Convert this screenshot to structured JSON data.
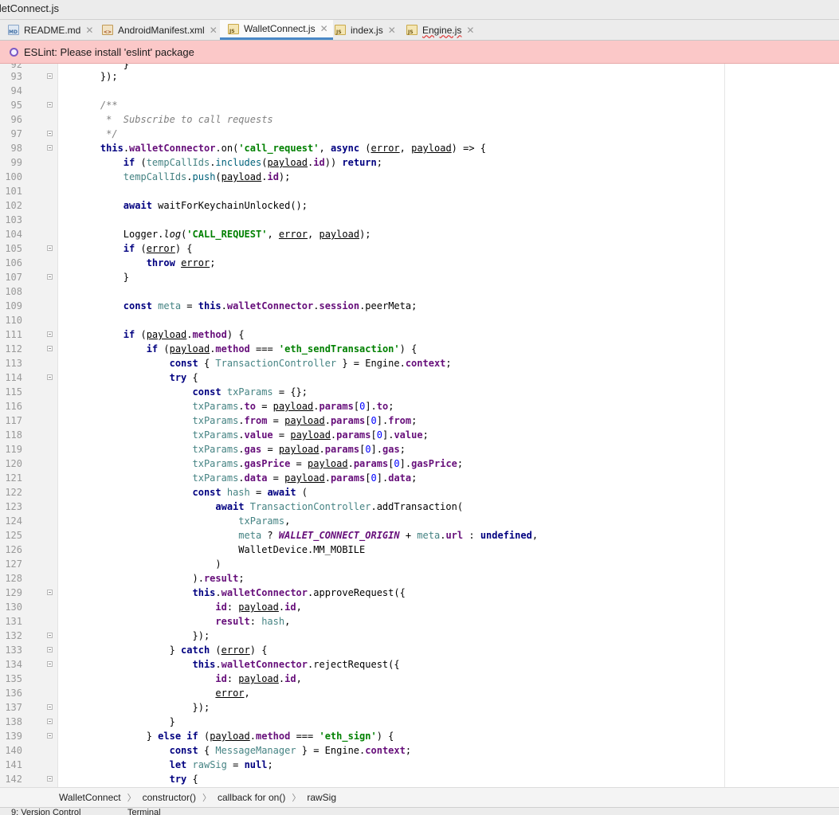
{
  "window": {
    "title": "lletConnect.js"
  },
  "tabs": [
    {
      "label": "README.md",
      "icon": "markdown-file-icon"
    },
    {
      "label": "AndroidManifest.xml",
      "icon": "xml-file-icon"
    },
    {
      "label": "WalletConnect.js",
      "icon": "js-file-icon",
      "active": true
    },
    {
      "label": "index.js",
      "icon": "js-file-icon"
    },
    {
      "label": "Engine.js",
      "icon": "js-file-icon",
      "error": true
    }
  ],
  "banner": {
    "text": "ESLint: Please install 'eslint' package"
  },
  "editor": {
    "top_partial": "}",
    "lines": [
      {
        "n": "92"
      },
      {
        "n": "93"
      },
      {
        "n": "94"
      },
      {
        "n": "95"
      },
      {
        "n": "96"
      },
      {
        "n": "97"
      },
      {
        "n": "98"
      },
      {
        "n": "99"
      },
      {
        "n": "100"
      },
      {
        "n": "101"
      },
      {
        "n": "102"
      },
      {
        "n": "103"
      },
      {
        "n": "104"
      },
      {
        "n": "105"
      },
      {
        "n": "106"
      },
      {
        "n": "107"
      },
      {
        "n": "108"
      },
      {
        "n": "109"
      },
      {
        "n": "110"
      },
      {
        "n": "111"
      },
      {
        "n": "112"
      },
      {
        "n": "113"
      },
      {
        "n": "114"
      },
      {
        "n": "115"
      },
      {
        "n": "116"
      },
      {
        "n": "117"
      },
      {
        "n": "118"
      },
      {
        "n": "119"
      },
      {
        "n": "120"
      },
      {
        "n": "121"
      },
      {
        "n": "122"
      },
      {
        "n": "123"
      },
      {
        "n": "124"
      },
      {
        "n": "125"
      },
      {
        "n": "126"
      },
      {
        "n": "127"
      },
      {
        "n": "128"
      },
      {
        "n": "129"
      },
      {
        "n": "130"
      },
      {
        "n": "131"
      },
      {
        "n": "132"
      },
      {
        "n": "133"
      },
      {
        "n": "134"
      },
      {
        "n": "135"
      },
      {
        "n": "136"
      },
      {
        "n": "137"
      },
      {
        "n": "138"
      },
      {
        "n": "139"
      },
      {
        "n": "140"
      },
      {
        "n": "141"
      },
      {
        "n": "142"
      }
    ]
  },
  "breadcrumb": [
    "WalletConnect",
    "constructor()",
    "callback for on()",
    "rawSig"
  ],
  "statusbar": {
    "version_control": "9: Version Control",
    "terminal": "Terminal"
  }
}
